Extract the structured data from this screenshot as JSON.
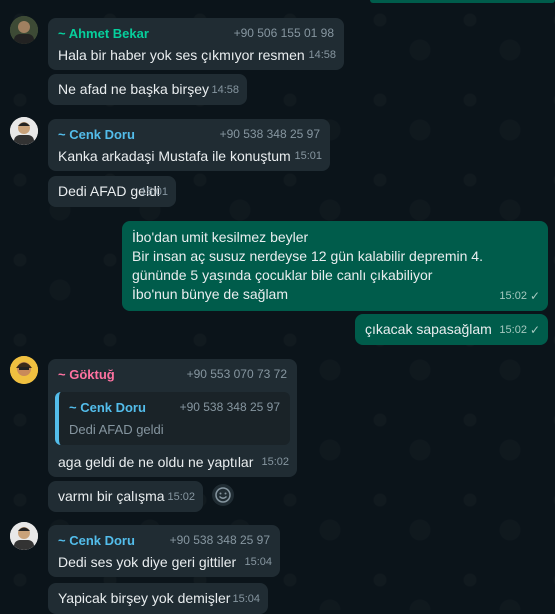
{
  "messages": {
    "m1": {
      "sender": "~ Ahmet Bekar",
      "phone": "+90 506 155 01 98",
      "text": "Hala bir haber yok ses çıkmıyor resmen",
      "time": "14:58"
    },
    "m2": {
      "text": "Ne afad ne başka birşey",
      "time": "14:58"
    },
    "m3": {
      "sender": "~ Cenk Doru",
      "phone": "+90 538 348 25 97",
      "text": "Kanka arkadaşi Mustafa ile konuştum",
      "time": "15:01"
    },
    "m4": {
      "text": "Dedi AFAD geldi",
      "time": "15:01"
    },
    "m5": {
      "lines": [
        "İbo'dan umit kesilmez beyler",
        "Bir insan aç susuz nerdeyse 12 gün kalabilir depremin 4.",
        "gününde 5 yaşında çocuklar bile canlı çıkabiliyor",
        "İbo'nun bünye de sağlam"
      ],
      "time": "15:02"
    },
    "m6": {
      "text": "çıkacak sapasağlam",
      "time": "15:02"
    },
    "m7": {
      "sender": "~ Göktuğ",
      "phone": "+90 553 070 73 72",
      "quote": {
        "sender": "~ Cenk Doru",
        "phone": "+90 538 348 25 97",
        "text": "Dedi AFAD geldi"
      },
      "text": "aga geldi de ne oldu ne yaptılar",
      "time": "15:02"
    },
    "m8": {
      "text": "varmı bir çalışma",
      "time": "15:02"
    },
    "m9": {
      "sender": "~ Cenk Doru",
      "phone": "+90 538 348 25 97",
      "text": "Dedi ses yok diye geri gittiler",
      "time": "15:04"
    },
    "m10": {
      "text": "Yapicak birşey yok demişler",
      "time": "15:04"
    }
  },
  "colors": {
    "ahmet": "#06cf9c",
    "cenk": "#53bdeb",
    "goktug": "#ff72a1"
  },
  "icons": {
    "read_receipt": "double-check-icon",
    "react": "emoji-smile-icon"
  }
}
